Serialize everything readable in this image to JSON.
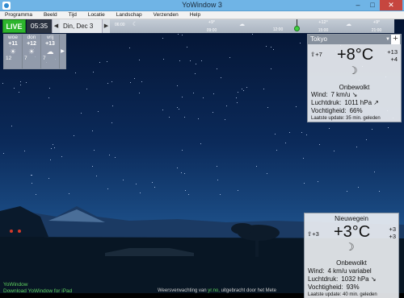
{
  "window": {
    "title": "YoWindow 3",
    "minimize": "–",
    "maximize": "□",
    "close": "✕"
  },
  "menu": [
    "Programma",
    "Beeld",
    "Tijd",
    "Locatie",
    "Landschap",
    "Verzenden",
    "Help"
  ],
  "toolbar": {
    "live_label": "LIVE",
    "time": "05:35",
    "prev_arrow": "◀",
    "date": "Din, Dec 3",
    "next_arrow": "▶",
    "timeline": [
      {
        "time": "06:00",
        "temp": "",
        "icon": "moon-icon"
      },
      {
        "time": "",
        "temp": "",
        "icon": ""
      },
      {
        "time": "09:00",
        "temp": "+9°",
        "icon": "sun-icon"
      },
      {
        "time": "12:00",
        "temp": "",
        "icon": "cloud-icon"
      },
      {
        "time": "15:00",
        "temp": "+12°",
        "icon": "cloud-icon"
      },
      {
        "time": "",
        "temp": "",
        "icon": "cloud-icon"
      },
      {
        "time": "21:00",
        "temp": "+9°",
        "icon": "cloud-icon"
      }
    ]
  },
  "forecast": {
    "days": [
      {
        "name": "woe",
        "hi": "+11",
        "lo": "12"
      },
      {
        "name": "don",
        "hi": "+12",
        "lo": "7"
      },
      {
        "name": "vrij",
        "hi": "+13",
        "lo": "7"
      }
    ],
    "expand_arrow": "▶"
  },
  "tokyo": {
    "city": "Tokyo",
    "dropdown": "▼",
    "add": "+",
    "temp": "+8°C",
    "feels": "+7",
    "hi": "+13",
    "lo": "+4",
    "condition": "Onbewolkt",
    "wind_label": "Wind:",
    "wind_value": "7 km/u ↘",
    "pressure_label": "Luchtdruk:",
    "pressure_value": "1011 hPa ↗",
    "humidity_label": "Vochtigheid:",
    "humidity_value": "66%",
    "update": "Laatste update: 35 min. geleden"
  },
  "nieuwegein": {
    "city": "Nieuwegein",
    "temp": "+3°C",
    "feels": "+3",
    "hi": "+3",
    "lo": "+3",
    "condition": "Onbewolkt",
    "wind_label": "Wind:",
    "wind_value": "4 km/u variabel",
    "pressure_label": "Luchtdruk:",
    "pressure_value": "1032 hPa ↘",
    "humidity_label": "Vochtigheid:",
    "humidity_value": "93%",
    "update": "Laatste update: 40 min. geleden"
  },
  "footer": {
    "app_label": "YoWindow",
    "ipad_link": "Download YoWindow for iPad",
    "credit_prefix": "Weersverwachting van",
    "credit_link": "yr.no,",
    "credit_suffix": "uitgebracht door het Mete"
  },
  "colors": {
    "live": "#2db52d",
    "titlebar": "#6fb4e6",
    "close": "#c6463f",
    "link": "#5fd05f"
  }
}
